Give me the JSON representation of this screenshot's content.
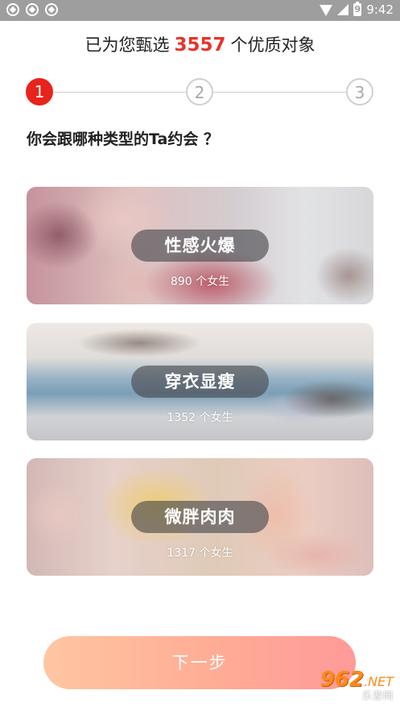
{
  "status_bar": {
    "time": "9:42",
    "battery_level": "9"
  },
  "headline": {
    "prefix": "已为您甄选",
    "count": "3557",
    "suffix": "个优质对象"
  },
  "steps": {
    "items": [
      "1",
      "2",
      "3"
    ],
    "active_index": 0
  },
  "question": "你会跟哪种类型的Ta约会 ？",
  "options": [
    {
      "label": "性感火爆",
      "count_text": "890 个女生"
    },
    {
      "label": "穿衣显瘦",
      "count_text": "1352 个女生"
    },
    {
      "label": "微胖肉肉",
      "count_text": "1317 个女生"
    }
  ],
  "next_button": {
    "label": "下一步"
  },
  "watermark": {
    "logo": "962",
    "suffix": ".NET",
    "subtitle": "乐游网"
  },
  "colors": {
    "accent": "#e8332b",
    "button_gradient_start": "#ffc6a2",
    "button_gradient_end": "#ff9a9a"
  }
}
